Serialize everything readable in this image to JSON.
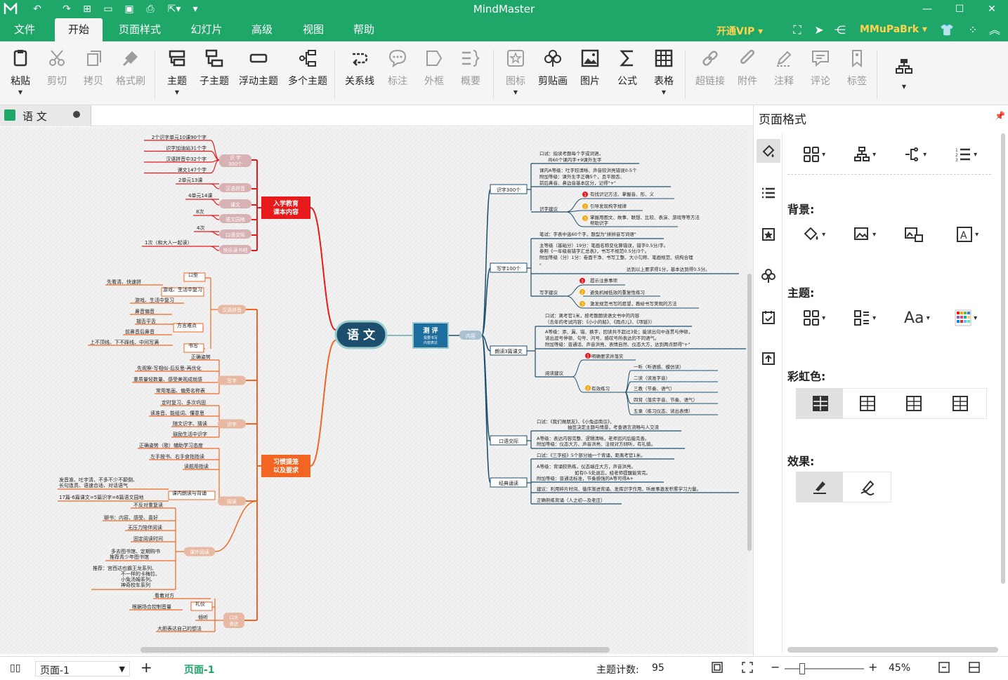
{
  "app": {
    "title": "MindMaster"
  },
  "menu": {
    "tabs": [
      "文件",
      "开始",
      "页面样式",
      "幻灯片",
      "高级",
      "视图",
      "帮助"
    ],
    "active": "开始",
    "vip": "开通VIP",
    "user": "MMuPaBrk"
  },
  "ribbon": {
    "buttons": [
      {
        "label": "粘贴",
        "icon": "clipboard-icon",
        "enabled": true,
        "caret": true
      },
      {
        "label": "剪切",
        "icon": "scissors-icon",
        "enabled": false
      },
      {
        "label": "拷贝",
        "icon": "copy-icon",
        "enabled": false
      },
      {
        "label": "格式刷",
        "icon": "format-brush-icon",
        "enabled": false
      },
      {
        "label": "主题",
        "icon": "topic-icon",
        "enabled": true,
        "caret": true
      },
      {
        "label": "子主题",
        "icon": "subtopic-icon",
        "enabled": true
      },
      {
        "label": "浮动主题",
        "icon": "floating-topic-icon",
        "enabled": true
      },
      {
        "label": "多个主题",
        "icon": "multiple-topics-icon",
        "enabled": true
      },
      {
        "label": "关系线",
        "icon": "relationship-icon",
        "enabled": true
      },
      {
        "label": "标注",
        "icon": "callout-icon",
        "enabled": false
      },
      {
        "label": "外框",
        "icon": "boundary-icon",
        "enabled": false
      },
      {
        "label": "概要",
        "icon": "summary-icon",
        "enabled": false
      },
      {
        "label": "图标",
        "icon": "mark-icon",
        "enabled": false,
        "caret": true
      },
      {
        "label": "剪贴画",
        "icon": "clipart-icon",
        "enabled": true
      },
      {
        "label": "图片",
        "icon": "picture-icon",
        "enabled": true
      },
      {
        "label": "公式",
        "icon": "formula-icon",
        "enabled": true
      },
      {
        "label": "表格",
        "icon": "table-icon",
        "enabled": true,
        "caret": true
      },
      {
        "label": "超链接",
        "icon": "hyperlink-icon",
        "enabled": false
      },
      {
        "label": "附件",
        "icon": "attachment-icon",
        "enabled": false
      },
      {
        "label": "注释",
        "icon": "note-icon",
        "enabled": false
      },
      {
        "label": "评论",
        "icon": "comment-icon",
        "enabled": false
      },
      {
        "label": "标签",
        "icon": "tag-icon",
        "enabled": false
      }
    ]
  },
  "doc_tab": {
    "name": "语 文"
  },
  "panel": {
    "title": "页面格式",
    "background_label": "背景:",
    "theme_label": "主题:",
    "font_label": "Aa",
    "rainbow_label": "彩虹色:",
    "effect_label": "效果:"
  },
  "status": {
    "page_select": "页面-1",
    "page_tab": "页面-1",
    "topic_count_label": "主题计数:",
    "topic_count": "95",
    "zoom": "45%",
    "zoom_level": 0.45
  },
  "mindmap": {
    "center": "语 文",
    "left": [
      {
        "title": [
          "入学教育",
          "课本内容"
        ],
        "color": "#e8191b",
        "children": [
          {
            "label": "识 字 300个",
            "leaves": [
              "2个识字单元10课90个字",
              "识字加油站31个字",
              "汉语拼音中32个字",
              "课文147个字"
            ]
          },
          {
            "label": "汉语拼音",
            "leaves": [
              "2单元13课"
            ]
          },
          {
            "label": "课文",
            "leaves": [
              "4单元14课"
            ]
          },
          {
            "label": "语文园地",
            "leaves": [
              "8次"
            ]
          },
          {
            "label": "口语交际",
            "leaves": [
              "4次"
            ]
          },
          {
            "label": "快乐读书吧",
            "leaves": [
              "1次（和大人一起读）"
            ]
          }
        ]
      },
      {
        "title": [
          "习惯提笼",
          "以及要求"
        ],
        "color": "#f26522",
        "children": [
          {
            "label": "汉语拼音",
            "leaves": [
              "口型",
              "先看清、快速拼",
              "每日练习拼读",
              "游戏、生活中复习",
              "鼻音偏音",
              "翘舌平舌",
              "前鼻音后鼻音",
              "方言难点",
              "上不顶线、下不踩线、中间写满",
              "书写"
            ]
          },
          {
            "label": "写字",
            "leaves": [
              "正确姿势",
              "先观察-写相似-后反思-再优化",
              "重质量轻数量、感受美观成就感",
              "常用笔画、偏旁名称表"
            ]
          },
          {
            "label": "识字",
            "leaves": [
              "定时复习、多次巩固",
              "读准音、能组词、懂意思",
              "随文识字、猜读",
              "鼓励生活中识字"
            ]
          },
          {
            "label": "阅读",
            "leaves": [
              "正确姿势（歌）辅助学习态度",
              "左手按书、右手食指指读",
              "读题用指读",
              "发音准、吐字清、不多不少不颠倒、长句连贯、语速合适、对话语气",
              "17篇-6篇课文=5篇识字=6篇语文园地",
              "课内朗读与背诵"
            ]
          },
          {
            "label": "课外阅读",
            "leaves": [
              "不反对重复读",
              "聊书：内容、感受、喜好",
              "无压力陪伴阅读",
              "固定阅读时间",
              "多去图书馆、定期购书 推荐青少年图书馆",
              "推荐：宫西达也霸王龙系列、不一样的卡梅拉、小兔汤姆系列、神奇校车系列"
            ]
          },
          {
            "label": "口头表达",
            "leaves": [
              "看着对方",
              "根据场合控制音量",
              "礼仪",
              "倾听",
              "大胆表达自己的想法"
            ]
          }
        ]
      }
    ],
    "right": {
      "title": [
        "测 评",
        "需要书写",
        "内容表达"
      ],
      "tag": "内容",
      "children": [
        {
          "label": "识字300个",
          "lines": [
            "口试：指读考题每个字或词语，",
            "共60个课内字+9课外生字",
            "课内A等级：吐字较清晰、声音较洪亮错误0-5个",
            "附加等级：课外生字正确5个，且平翘舌、",
            "前后鼻音、鼻边音基本区分，记得\"+\"",
            "识字建议",
            "有找识记方法、掌握音、形、义",
            "引导发现构字规律",
            "掌握用图文、故事、联想、比较、表演、游戏等等方法帮助识字"
          ]
        },
        {
          "label": "写字100个",
          "lines": [
            "笔试：字表中选60个字，题型为\"拼拼音写词语\"",
            "主等级（基础分）19分：笔画名称变化算错误，错字0.5分/字。",
            "参照《一年级易错字汇总表》，书写不规范0.5分/3个。",
            "附加等级（分）1分：卷面干净、书写工整、大小匀称、笔画规范、结构合理。",
            "达到以上要求得1分，基本达到得0.5分。",
            "写字建议",
            "提示注意事项",
            "避免机械低效的重复性练习",
            "激发规范书写的愿望，教给书写美观的方法"
          ]
        },
        {
          "label": "朗读3篇课文",
          "lines": [
            "口试：离考官1米，按考题朗读语文书中的内容",
            "（去年的考试内容：《小小的船》、《雨点儿》、《项链》）",
            "A等级：添、漏、错、换字，回读共不超过3处；能读出句中连贯与停顿，",
            "读出逗号停顿、句号、问号、感叹号所表达的不同语气。",
            "附加等级：普通话、声音洪亮、表情自然、仪态大方，达到两点即得\"+\"",
            "阅读建议",
            "明确要求并落实",
            "有效练习",
            "一听（听语感、模仿读）",
            "二读（读准字音）",
            "三教（节奏、语气）",
            "四背（落实字音、节奏、语气）",
            "五录（练习仪态、读出表情）"
          ]
        },
        {
          "label": "口语交际",
          "lines": [
            "口试：《我们做朋友》、《小兔运南瓜》，",
            "抽签决定主题与情景，考查语言流畅与人交流",
            "A等级：表达内容完整、逻辑清晰，老师追问后能完善。",
            "附加等级：仪态大方、声音洪亮、注视对方倾听，有礼貌。"
          ]
        },
        {
          "label": "经典诵读",
          "lines": [
            "口试：《三字经》5个部分抽一个背诵，距离考官1米。",
            "A等级：背诵较熟练，仪态端庄大方，声音洪亮。",
            "如有0-5处退忘，经老师提醒能背完。",
            "附加等级：普通话标准，节奏感强的A等可得A+",
            "建议：利用碎片时间、循序渐进背诵、发挥识字作用、听故事激发积累学习力量。",
            "正确熟练背诵（人之初—及老庄）"
          ]
        }
      ]
    }
  }
}
